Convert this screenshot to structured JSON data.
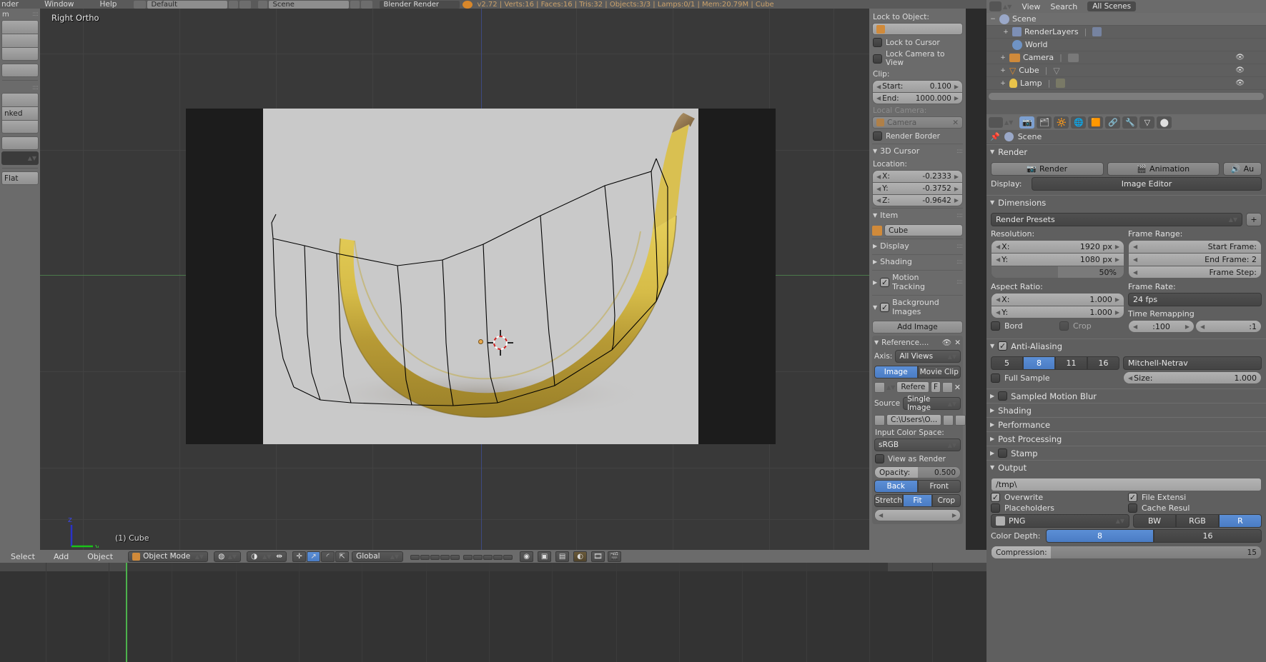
{
  "topbar": {
    "menus": [
      "nder",
      "Window",
      "Help"
    ],
    "screen_layout": "Default",
    "scene_name": "Scene",
    "render_engine": "Blender Render",
    "stats": "v2.72 | Verts:16 | Faces:16 | Tris:32 | Objects:3/3 | Lamps:0/1 | Mem:20.79M | Cube"
  },
  "toolshelf": {
    "header": "m",
    "buttons": [
      "",
      "",
      "",
      ""
    ],
    "linked_label": "nked",
    "shading_label": "Flat"
  },
  "viewport": {
    "view_label": "Right Ortho",
    "object_label": "(1) Cube",
    "gizmo_z": "z",
    "gizmo_y": "y"
  },
  "npanel": {
    "lock_to_object_label": "Lock to Object:",
    "lock_to_object_value": "",
    "lock_to_cursor": "Lock to Cursor",
    "lock_camera_to_view": "Lock Camera to View",
    "clip_label": "Clip:",
    "clip_start_label": "Start:",
    "clip_start_value": "0.100",
    "clip_end_label": "End:",
    "clip_end_value": "1000.000",
    "local_camera_label": "Local Camera:",
    "local_camera_value": "Camera",
    "render_border": "Render Border",
    "cursor_section": "3D Cursor",
    "location_label": "Location:",
    "cursor_x_label": "X:",
    "cursor_x_value": "-0.2333",
    "cursor_y_label": "Y:",
    "cursor_y_value": "-0.3752",
    "cursor_z_label": "Z:",
    "cursor_z_value": "-0.9642",
    "item_section": "Item",
    "item_name": "Cube",
    "display_section": "Display",
    "shading_section": "Shading",
    "motion_tracking_section": "Motion Tracking",
    "background_images_section": "Background Images",
    "add_image_button": "Add Image",
    "reference_label": "Reference....",
    "axis_label": "Axis:",
    "axis_value": "All Views",
    "source_type_image": "Image",
    "source_type_movieclip": "Movie Clip",
    "datablock_name": "Refere",
    "fake_user": "F",
    "source_label": "Source",
    "source_value": "Single Image",
    "filepath": "C:\\Users\\O...",
    "color_space_label": "Input Color Space:",
    "color_space_value": "sRGB",
    "view_as_render": "View as Render",
    "opacity_label": "Opacity:",
    "opacity_value": "0.500",
    "depth_back": "Back",
    "depth_front": "Front",
    "frame_stretch": "Stretch",
    "frame_fit": "Fit",
    "frame_crop": "Crop"
  },
  "outliner": {
    "view_menu": "View",
    "search_menu": "Search",
    "display_mode": "All Scenes",
    "rows": [
      {
        "label": "Scene",
        "indent": 0,
        "icon": "scene-icon",
        "expand": "−",
        "eye": false
      },
      {
        "label": "RenderLayers",
        "indent": 1,
        "icon": "renderlayers-icon",
        "expand": "+",
        "eye": false
      },
      {
        "label": "World",
        "indent": 1,
        "icon": "world-icon",
        "expand": "",
        "eye": false
      },
      {
        "label": "Camera",
        "indent": 1,
        "icon": "camera-icon",
        "expand": "+",
        "eye": true
      },
      {
        "label": "Cube",
        "indent": 1,
        "icon": "mesh-icon",
        "expand": "+",
        "eye": true
      },
      {
        "label": "Lamp",
        "indent": 1,
        "icon": "lamp-icon",
        "expand": "+",
        "eye": true
      }
    ]
  },
  "properties": {
    "breadcrumb": "Scene",
    "render_section": "Render",
    "render_button": "Render",
    "animation_button": "Animation",
    "audio_button": "Au",
    "display_label": "Display:",
    "display_value": "Image Editor",
    "dimensions_section": "Dimensions",
    "render_presets": "Render Presets",
    "resolution_label": "Resolution:",
    "res_x_label": "X:",
    "res_x_value": "1920 px",
    "res_y_label": "Y:",
    "res_y_value": "1080 px",
    "res_percent": "50%",
    "frame_range_label": "Frame Range:",
    "start_frame_label": "Start Frame:",
    "end_frame_label": "End Frame: 2",
    "frame_step_label": "Frame Step:",
    "aspect_label": "Aspect Ratio:",
    "aspect_x_label": "X:",
    "aspect_x_value": "1.000",
    "aspect_y_label": "Y:",
    "aspect_y_value": "1.000",
    "frame_rate_label": "Frame Rate:",
    "frame_rate_value": "24 fps",
    "time_remapping_label": "Time Remapping",
    "remap_old": ":100",
    "remap_new": ":1",
    "border_label": "Bord",
    "crop_label": "Crop",
    "aa_section": "Anti-Aliasing",
    "aa_samples": [
      "5",
      "8",
      "11",
      "16"
    ],
    "aa_selected": "8",
    "aa_filter": "Mitchell-Netrav",
    "full_sample": "Full Sample",
    "aa_size_label": "Size:",
    "aa_size_value": "1.000",
    "motion_blur_section": "Sampled Motion Blur",
    "shading_section": "Shading",
    "performance_section": "Performance",
    "post_processing_section": "Post Processing",
    "stamp_section": "Stamp",
    "output_section": "Output",
    "output_path": "/tmp\\",
    "overwrite": "Overwrite",
    "file_extensions": "File Extensi",
    "placeholders": "Placeholders",
    "cache_result": "Cache Resul",
    "file_format": "PNG",
    "color_modes": [
      "BW",
      "RGB",
      "R"
    ],
    "color_mode_selected": "R",
    "color_depth_label": "Color Depth:",
    "color_depths": [
      "8",
      "16"
    ],
    "color_depth_selected": "8",
    "compression_label": "Compression:",
    "compression_value": "15"
  },
  "footer": {
    "select": "Select",
    "add": "Add",
    "object": "Object",
    "mode": "Object Mode",
    "transform_orientation": "Global"
  },
  "colors": {
    "accent_blue": "#4a7cc4",
    "panel_grey": "#6b6b6b",
    "viewport_bg": "#393939",
    "stats_orange": "#c9a06a"
  }
}
